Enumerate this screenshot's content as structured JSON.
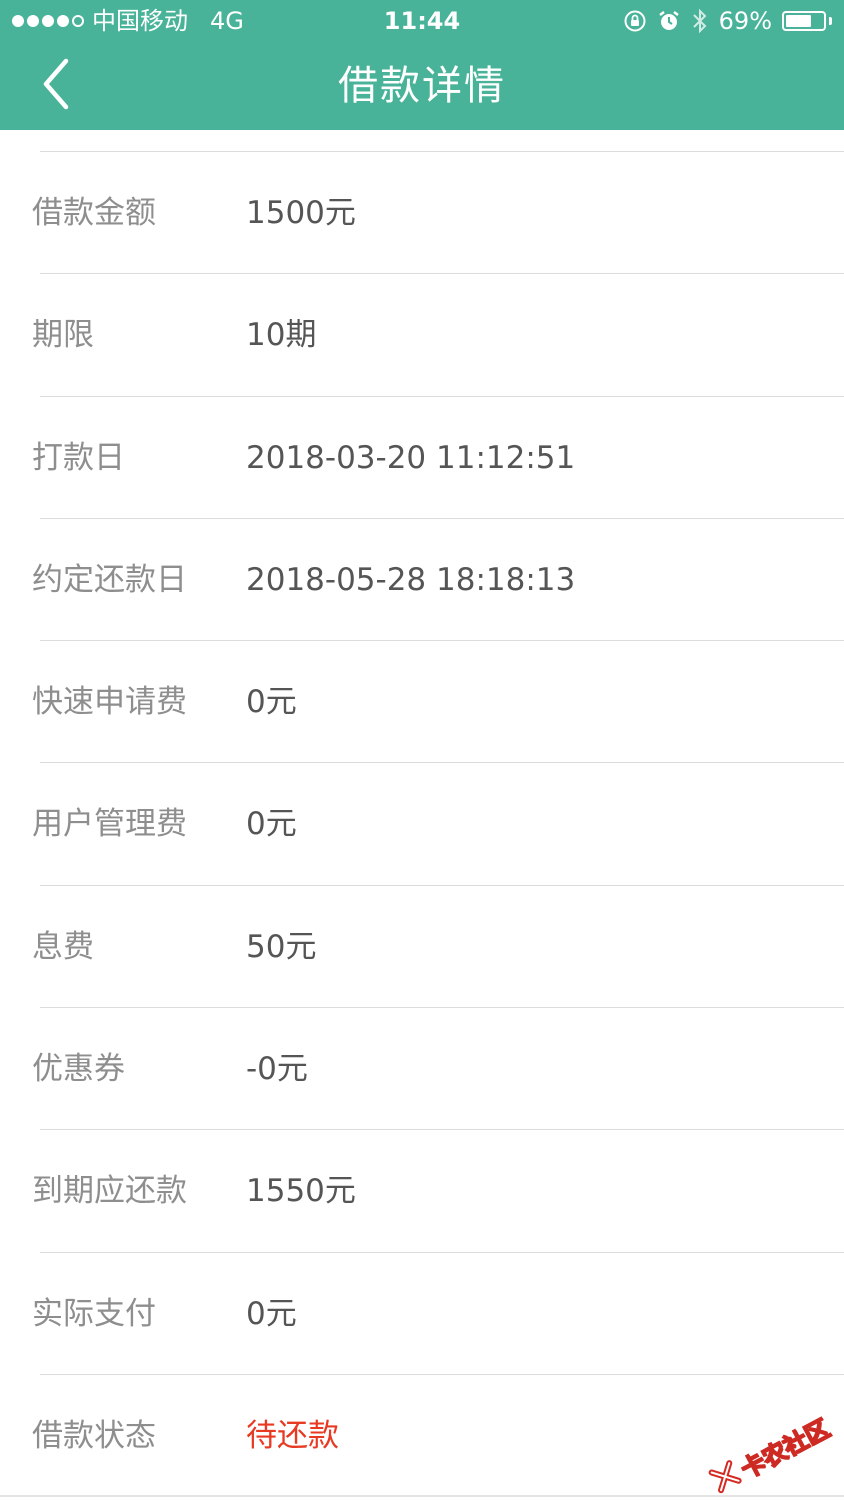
{
  "status_bar": {
    "carrier": "中国移动",
    "network": "4G",
    "time": "11:44",
    "battery_percent": "69%",
    "battery_level": 0.69,
    "signal_bars": 4,
    "icons": [
      "orientation-lock-icon",
      "alarm-icon",
      "bluetooth-icon",
      "battery-icon"
    ]
  },
  "nav": {
    "title": "借款详情",
    "back_icon": "chevron-left-icon"
  },
  "colors": {
    "header": "#48b398",
    "label": "#8e8e8e",
    "value": "#555555",
    "status_pending": "#e83a22"
  },
  "details": [
    {
      "label": "借款金额",
      "value": "1500元"
    },
    {
      "label": "期限",
      "value": "10期"
    },
    {
      "label": "打款日",
      "value": "2018-03-20 11:12:51"
    },
    {
      "label": "约定还款日",
      "value": "2018-05-28 18:18:13"
    },
    {
      "label": "快速申请费",
      "value": "0元"
    },
    {
      "label": "用户管理费",
      "value": "0元"
    },
    {
      "label": "息费",
      "value": "50元"
    },
    {
      "label": "优惠券",
      "value": "-0元"
    },
    {
      "label": "到期应还款",
      "value": "1550元"
    },
    {
      "label": "实际支付",
      "value": "0元"
    },
    {
      "label": "借款状态",
      "value": "待还款"
    }
  ],
  "watermark": {
    "text": "卡农社区",
    "icon": "red-x-logo-icon"
  }
}
